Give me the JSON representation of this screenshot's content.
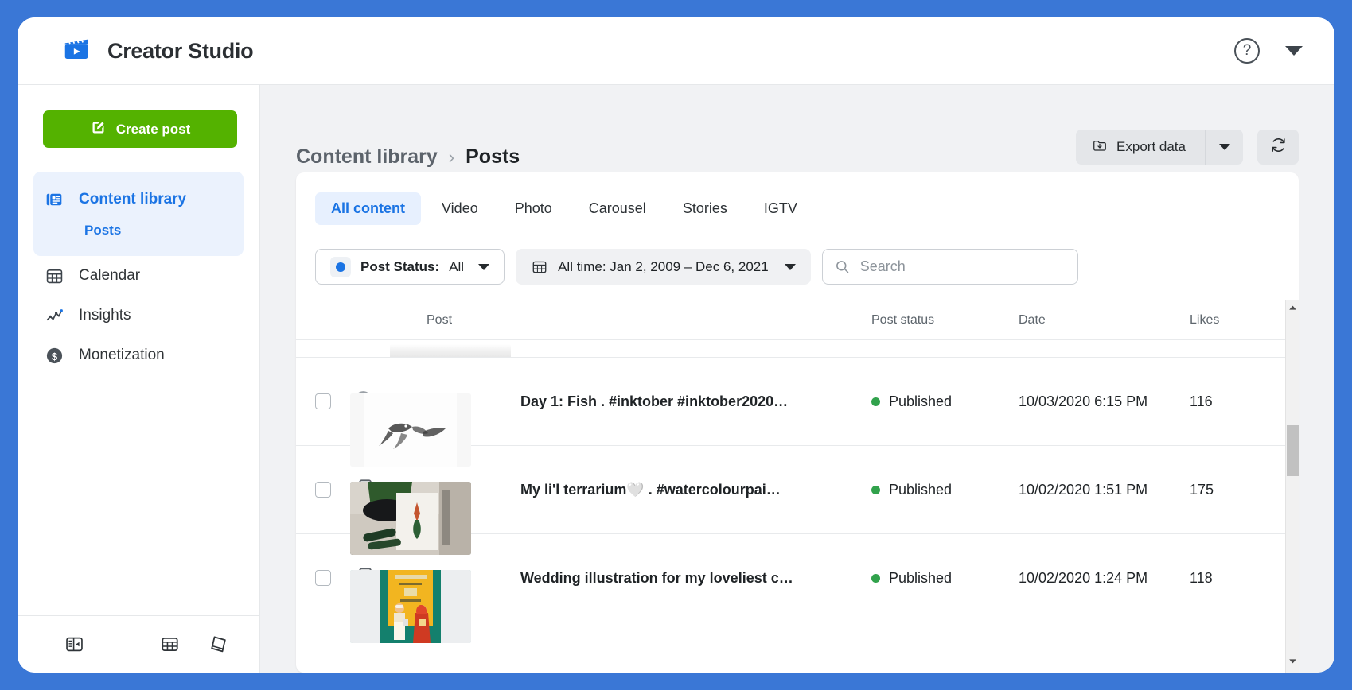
{
  "app": {
    "title": "Creator Studio",
    "logo_icon": "clapperboard-icon",
    "help_icon": "help-circle-icon",
    "account_caret_icon": "chevron-down-icon"
  },
  "sidebar": {
    "create_post_label": "Create post",
    "create_post_icon": "compose-icon",
    "items": [
      {
        "label": "Content library",
        "icon": "content-library-icon",
        "active": true,
        "sub": [
          {
            "label": "Posts",
            "active": true
          }
        ]
      },
      {
        "label": "Calendar",
        "icon": "calendar-icon",
        "active": false
      },
      {
        "label": "Insights",
        "icon": "insights-line-chart-icon",
        "active": false
      },
      {
        "label": "Monetization",
        "icon": "dollar-circle-icon",
        "active": false
      }
    ],
    "footer_icons": [
      "collapse-sidebar-icon",
      "grid-table-icon",
      "book-icon"
    ]
  },
  "breadcrumb": {
    "parent": "Content library",
    "separator": "›",
    "current": "Posts"
  },
  "toolbar": {
    "export_label": "Export data",
    "export_icon": "download-folder-icon",
    "export_caret_icon": "chevron-down-icon",
    "refresh_icon": "refresh-icon"
  },
  "tabs": [
    {
      "label": "All content",
      "active": true
    },
    {
      "label": "Video",
      "active": false
    },
    {
      "label": "Photo",
      "active": false
    },
    {
      "label": "Carousel",
      "active": false
    },
    {
      "label": "Stories",
      "active": false
    },
    {
      "label": "IGTV",
      "active": false
    }
  ],
  "filters": {
    "post_status": {
      "label": "Post Status:",
      "value": "All",
      "dot_color": "#1b74e4",
      "caret_icon": "chevron-down-icon"
    },
    "date_range": {
      "label": "All time:",
      "value": "Jan 2, 2009 – Dec 6, 2021",
      "full": "All time: Jan 2, 2009 – Dec 6, 2021",
      "icon": "calendar-icon",
      "caret_icon": "chevron-down-icon"
    },
    "search": {
      "placeholder": "Search",
      "value": "",
      "icon": "search-icon"
    }
  },
  "table": {
    "columns": [
      "Post",
      "Post status",
      "Date",
      "Likes"
    ],
    "rows": [
      {
        "type_icon": "photo-icon",
        "title": "Day 1: Fish . #inktober #inktober2020…",
        "status": "Published",
        "status_color": "#31a24c",
        "date": "10/03/2020 6:15 PM",
        "likes": "116",
        "thumb": "fish-ink-drawing"
      },
      {
        "type_icon": "carousel-icon",
        "title": "My li'l terrarium🤍 . #watercolourpai…",
        "status": "Published",
        "status_color": "#31a24c",
        "date": "10/02/2020 1:51 PM",
        "likes": "175",
        "thumb": "terrarium-photo"
      },
      {
        "type_icon": "carousel-icon",
        "title": "Wedding illustration for my loveliest c…",
        "status": "Published",
        "status_color": "#31a24c",
        "date": "10/02/2020 1:24 PM",
        "likes": "118",
        "thumb": "wedding-illustration"
      }
    ]
  },
  "scrollbar": {
    "up_icon": "caret-up-icon",
    "down_icon": "caret-down-icon"
  },
  "colors": {
    "brand_blue": "#1b74e4",
    "frame_blue": "#3a77d6",
    "create_green": "#54b200",
    "published_green": "#31a24c"
  }
}
